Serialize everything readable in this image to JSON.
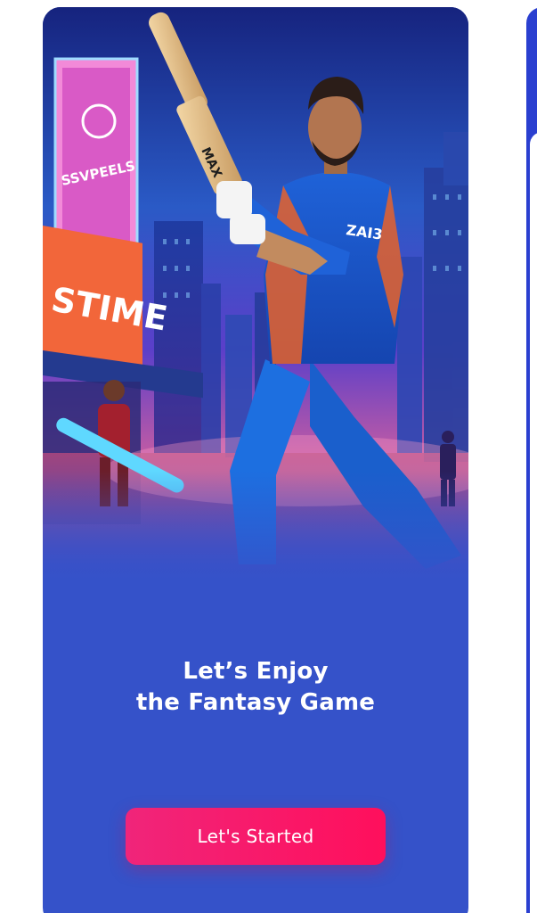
{
  "onboarding": {
    "headline_line1": "Let’s Enjoy",
    "headline_line2": "the Fantasy Game",
    "cta_label": "Let's Started"
  },
  "hero": {
    "billboard_top_text": "SSVPEELS",
    "billboard_bottom_text": "STIME",
    "jersey_text": "ZAI3",
    "bat_text": "MAX",
    "icon": "cricket-player-illustration"
  },
  "colors": {
    "card_background": "#3552c9",
    "cta_gradient_start": "#f0257a",
    "cta_gradient_end": "#ff0f5c",
    "next_card_accent": "#2a3fd0"
  }
}
